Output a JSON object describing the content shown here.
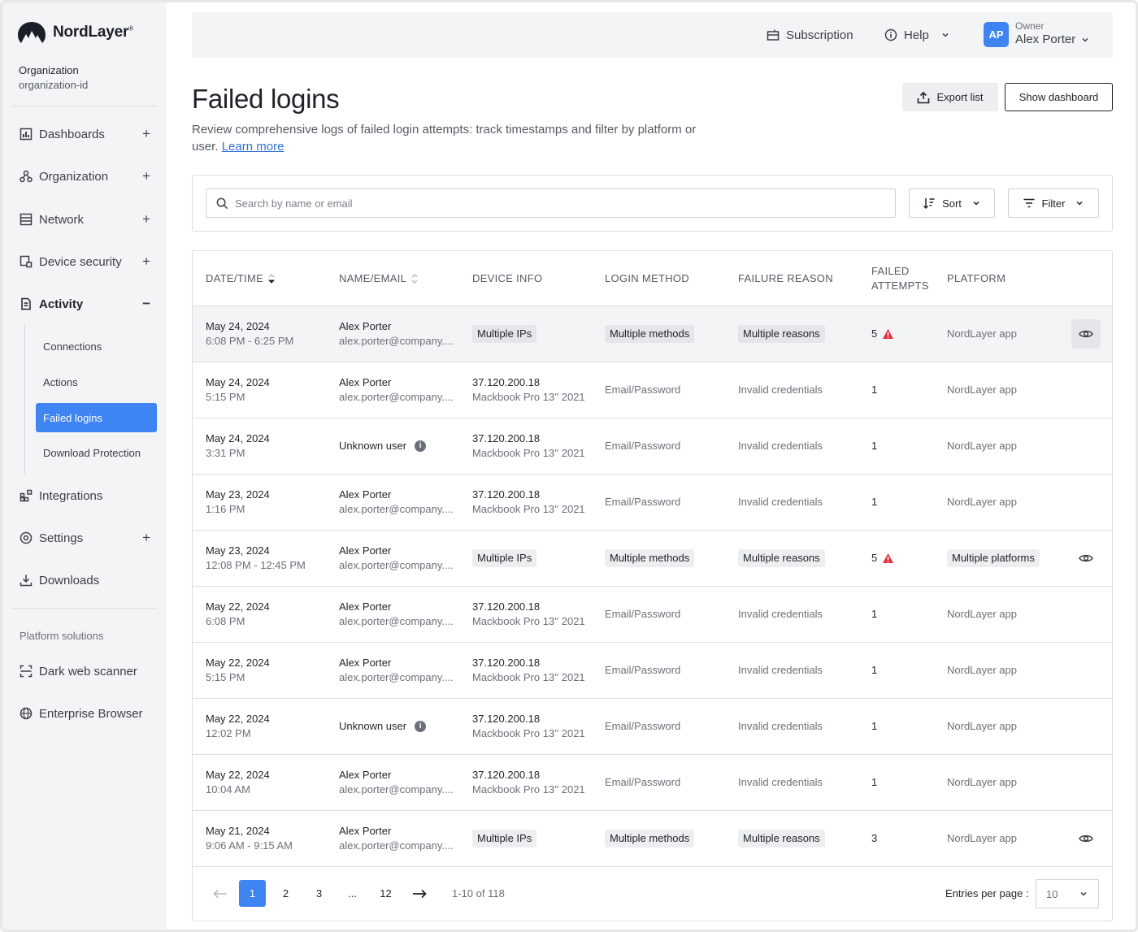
{
  "brand": {
    "name": "NordLayer",
    "mark": "®"
  },
  "organization": {
    "label": "Organization",
    "id": "organization-id"
  },
  "sidebar": {
    "items": [
      {
        "label": "Dashboards",
        "icon": "dashboard-icon",
        "expander": "+"
      },
      {
        "label": "Organization",
        "icon": "organization-icon",
        "expander": "+"
      },
      {
        "label": "Network",
        "icon": "network-icon",
        "expander": "+"
      },
      {
        "label": "Device security",
        "icon": "device-security-icon",
        "expander": "+"
      },
      {
        "label": "Activity",
        "icon": "activity-icon",
        "expander": "−"
      },
      {
        "label": "Integrations",
        "icon": "integrations-icon",
        "expander": ""
      },
      {
        "label": "Settings",
        "icon": "settings-icon",
        "expander": "+"
      },
      {
        "label": "Downloads",
        "icon": "download-icon",
        "expander": ""
      }
    ],
    "activity_sub": [
      "Connections",
      "Actions",
      "Failed logins",
      "Download Protection"
    ],
    "platform_label": "Platform solutions",
    "platform_items": [
      {
        "label": "Dark web scanner",
        "icon": "scanner-icon"
      },
      {
        "label": "Enterprise Browser",
        "icon": "globe-icon"
      }
    ]
  },
  "topbar": {
    "subscription": "Subscription",
    "help": "Help",
    "avatar_initials": "AP",
    "role": "Owner",
    "user_name": "Alex Porter"
  },
  "header": {
    "title": "Failed logins",
    "description": "Review comprehensive logs of failed login attempts: track timestamps and filter by platform or user.",
    "learn_more": "Learn more",
    "export_label": "Export list",
    "dashboard_label": "Show dashboard"
  },
  "search": {
    "placeholder": "Search by name or email",
    "value": ""
  },
  "controls": {
    "sort_label": "Sort",
    "filter_label": "Filter"
  },
  "table": {
    "columns": [
      "DATE/TIME",
      "NAME/EMAIL",
      "DEVICE INFO",
      "LOGIN METHOD",
      "FAILURE REASON",
      "FAILED ATTEMPTS",
      "PLATFORM"
    ],
    "rows": [
      {
        "date": "May 24, 2024",
        "time": "6:08 PM - 6:25 PM",
        "name": "Alex Porter",
        "email": "alex.porter@company....",
        "device": "Multiple IPs",
        "device_sub": "",
        "method": "Multiple methods",
        "reason": "Multiple reasons",
        "attempts": "5",
        "warn": true,
        "platform": "NordLayer app",
        "platform_chip": false,
        "multi": true,
        "unknown": false,
        "eye": true,
        "highlight": true
      },
      {
        "date": "May 24, 2024",
        "time": "5:15 PM",
        "name": "Alex Porter",
        "email": "alex.porter@company....",
        "device": "37.120.200.18",
        "device_sub": "Mackbook Pro 13'' 2021",
        "method": "Email/Password",
        "reason": "Invalid credentials",
        "attempts": "1",
        "warn": false,
        "platform": "NordLayer app",
        "platform_chip": false,
        "multi": false,
        "unknown": false,
        "eye": false,
        "highlight": false
      },
      {
        "date": "May 24, 2024",
        "time": "3:31 PM",
        "name": "Unknown user",
        "email": "",
        "device": "37.120.200.18",
        "device_sub": "Mackbook Pro 13'' 2021",
        "method": "Email/Password",
        "reason": "Invalid credentials",
        "attempts": "1",
        "warn": false,
        "platform": "NordLayer app",
        "platform_chip": false,
        "multi": false,
        "unknown": true,
        "eye": false,
        "highlight": false
      },
      {
        "date": "May 23, 2024",
        "time": "1:16 PM",
        "name": "Alex Porter",
        "email": "alex.porter@company....",
        "device": "37.120.200.18",
        "device_sub": "Mackbook Pro 13'' 2021",
        "method": "Email/Password",
        "reason": "Invalid credentials",
        "attempts": "1",
        "warn": false,
        "platform": "NordLayer app",
        "platform_chip": false,
        "multi": false,
        "unknown": false,
        "eye": false,
        "highlight": false
      },
      {
        "date": "May 23, 2024",
        "time": "12:08 PM - 12:45 PM",
        "name": "Alex Porter",
        "email": "alex.porter@company....",
        "device": "Multiple IPs",
        "device_sub": "",
        "method": "Multiple methods",
        "reason": "Multiple reasons",
        "attempts": "5",
        "warn": true,
        "platform": "Multiple platforms",
        "platform_chip": true,
        "multi": true,
        "unknown": false,
        "eye": true,
        "highlight": false
      },
      {
        "date": "May 22, 2024",
        "time": "6:08 PM",
        "name": "Alex Porter",
        "email": "alex.porter@company....",
        "device": "37.120.200.18",
        "device_sub": "Mackbook Pro 13'' 2021",
        "method": "Email/Password",
        "reason": "Invalid credentials",
        "attempts": "1",
        "warn": false,
        "platform": "NordLayer app",
        "platform_chip": false,
        "multi": false,
        "unknown": false,
        "eye": false,
        "highlight": false
      },
      {
        "date": "May 22, 2024",
        "time": "5:15 PM",
        "name": "Alex Porter",
        "email": "alex.porter@company....",
        "device": "37.120.200.18",
        "device_sub": "Mackbook Pro 13'' 2021",
        "method": "Email/Password",
        "reason": "Invalid credentials",
        "attempts": "1",
        "warn": false,
        "platform": "NordLayer app",
        "platform_chip": false,
        "multi": false,
        "unknown": false,
        "eye": false,
        "highlight": false
      },
      {
        "date": "May 22, 2024",
        "time": "12:02 PM",
        "name": "Unknown user",
        "email": "",
        "device": "37.120.200.18",
        "device_sub": "Mackbook Pro 13'' 2021",
        "method": "Email/Password",
        "reason": "Invalid credentials",
        "attempts": "1",
        "warn": false,
        "platform": "NordLayer app",
        "platform_chip": false,
        "multi": false,
        "unknown": true,
        "eye": false,
        "highlight": false
      },
      {
        "date": "May 22, 2024",
        "time": "10:04 AM",
        "name": "Alex Porter",
        "email": "alex.porter@company....",
        "device": "37.120.200.18",
        "device_sub": "Mackbook Pro 13'' 2021",
        "method": "Email/Password",
        "reason": "Invalid credentials",
        "attempts": "1",
        "warn": false,
        "platform": "NordLayer app",
        "platform_chip": false,
        "multi": false,
        "unknown": false,
        "eye": false,
        "highlight": false
      },
      {
        "date": "May 21, 2024",
        "time": "9:06 AM - 9:15 AM",
        "name": "Alex Porter",
        "email": "alex.porter@company....",
        "device": "Multiple IPs",
        "device_sub": "",
        "method": "Multiple methods",
        "reason": "Multiple reasons",
        "attempts": "3",
        "warn": false,
        "platform": "NordLayer app",
        "platform_chip": false,
        "multi": true,
        "unknown": false,
        "eye": true,
        "highlight": false
      }
    ]
  },
  "pagination": {
    "prev": "←",
    "next": "→",
    "pages": [
      "1",
      "2",
      "3",
      "...",
      "12"
    ],
    "current": "1",
    "range": "1-10 of 118",
    "per_page_label": "Entries per page :",
    "per_page_value": "10"
  },
  "colors": {
    "accent": "#3e84f2",
    "warning": "#e0313c",
    "sidebar_bg": "#f3f4f5"
  }
}
